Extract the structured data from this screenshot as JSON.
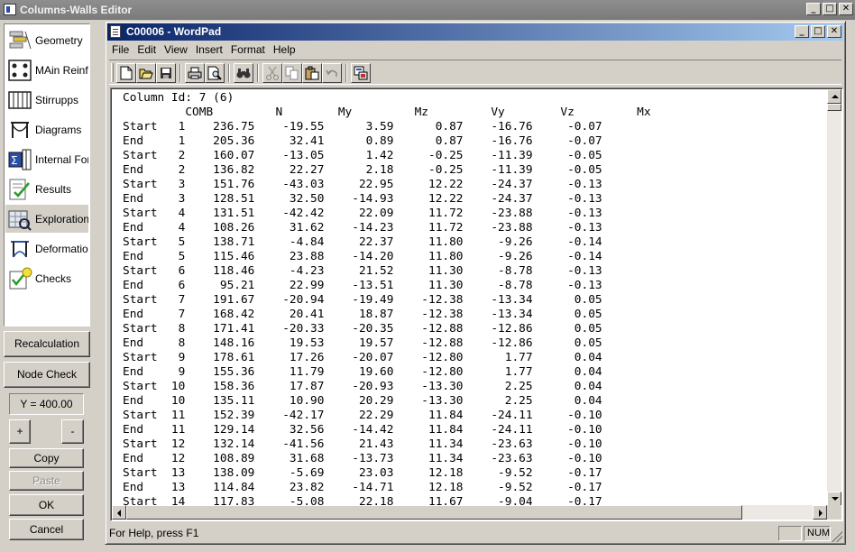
{
  "outer_window": {
    "title": "Columns-Walls Editor",
    "controls": {
      "minimize": "_",
      "maximize": "□",
      "close": "✕"
    }
  },
  "left_toolbar": {
    "items": [
      {
        "label": "Geometry",
        "icon": "geometry-icon"
      },
      {
        "label": "MAin Reinforcement",
        "icon": "main-reinforcement-icon"
      },
      {
        "label": "Stirrupps",
        "icon": "stirrups-icon"
      },
      {
        "label": "Diagrams",
        "icon": "diagrams-icon"
      },
      {
        "label": "Internal Forces",
        "icon": "internal-forces-icon"
      },
      {
        "label": "Results",
        "icon": "results-icon"
      },
      {
        "label": "Exploration",
        "icon": "exploration-icon",
        "active": true
      },
      {
        "label": "Deformations",
        "icon": "deformations-icon"
      },
      {
        "label": "Checks",
        "icon": "checks-icon"
      }
    ]
  },
  "buttons": {
    "recalculation": "Recalculation",
    "node_check": "Node Check",
    "y_readout": "Y = 400.00",
    "plus": "+",
    "minus": "-",
    "copy": "Copy",
    "paste": "Paste",
    "ok": "OK",
    "cancel": "Cancel"
  },
  "wordpad": {
    "title": "C00006 - WordPad",
    "menu": [
      "File",
      "Edit",
      "View",
      "Insert",
      "Format",
      "Help"
    ],
    "toolbar_icons": [
      "new-icon",
      "open-icon",
      "save-icon",
      "print-icon",
      "print-preview-icon",
      "find-icon",
      "cut-icon",
      "copy-icon",
      "paste-icon",
      "undo-icon",
      "insert-object-icon"
    ],
    "status_text": "For Help, press F1",
    "status_num": "NUM",
    "document": {
      "header_line": "Column Id: 7 (6)",
      "columns_line": "         COMB         N        My         Mz         Vy        Vz         Mx",
      "lines": [
        "Start   1    236.75    -19.55      3.59      0.87    -16.76     -0.07",
        "End     1    205.36     32.41      0.89      0.87    -16.76     -0.07",
        "Start   2    160.07    -13.05      1.42     -0.25    -11.39     -0.05",
        "End     2    136.82     22.27      2.18     -0.25    -11.39     -0.05",
        "Start   3    151.76    -43.03     22.95     12.22    -24.37     -0.13",
        "End     3    128.51     32.50    -14.93     12.22    -24.37     -0.13",
        "Start   4    131.51    -42.42     22.09     11.72    -23.88     -0.13",
        "End     4    108.26     31.62    -14.23     11.72    -23.88     -0.13",
        "Start   5    138.71     -4.84     22.37     11.80     -9.26     -0.14",
        "End     5    115.46     23.88    -14.20     11.80     -9.26     -0.14",
        "Start   6    118.46     -4.23     21.52     11.30     -8.78     -0.13",
        "End     6     95.21     22.99    -13.51     11.30     -8.78     -0.13",
        "Start   7    191.67    -20.94    -19.49    -12.38    -13.34      0.05",
        "End     7    168.42     20.41     18.87    -12.38    -13.34      0.05",
        "Start   8    171.41    -20.33    -20.35    -12.88    -12.86      0.05",
        "End     8    148.16     19.53     19.57    -12.88    -12.86      0.05",
        "Start   9    178.61     17.26    -20.07    -12.80      1.77      0.04",
        "End     9    155.36     11.79     19.60    -12.80      1.77      0.04",
        "Start  10    158.36     17.87    -20.93    -13.30      2.25      0.04",
        "End    10    135.11     10.90     20.29    -13.30      2.25      0.04",
        "Start  11    152.39    -42.17     22.29     11.84    -24.11     -0.10",
        "End    11    129.14     32.56    -14.42     11.84    -24.11     -0.10",
        "Start  12    132.14    -41.56     21.43     11.34    -23.63     -0.10",
        "End    12    108.89     31.68    -13.73     11.34    -23.63     -0.10",
        "Start  13    138.09     -5.69     23.03     12.18     -9.52     -0.17",
        "End    13    114.84     23.82    -14.71     12.18     -9.52     -0.17",
        "Start  14    117.83     -5.08     22.18     11.67     -9.04     -0.17"
      ]
    }
  }
}
